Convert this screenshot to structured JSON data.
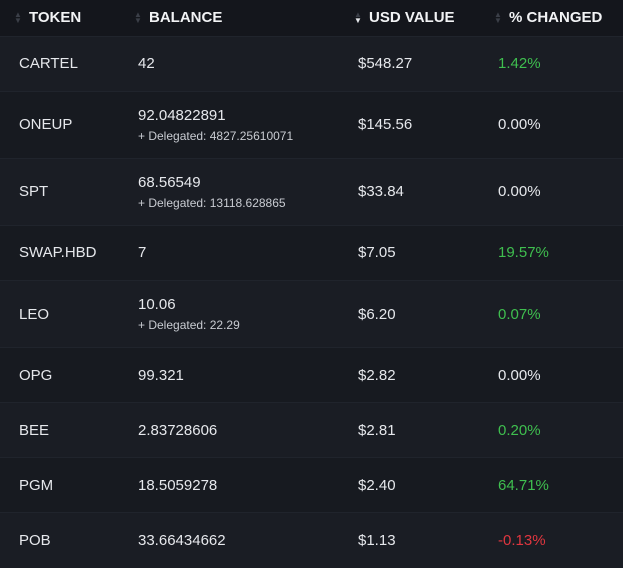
{
  "header": {
    "token": "TOKEN",
    "balance": "BALANCE",
    "usd_value": "USD VALUE",
    "changed": "% CHANGED",
    "sort_icon": "sort-updown-icon",
    "active_sort": "usd_value-descending"
  },
  "colors": {
    "positive": "#3fbf4f",
    "neutral": "#e6e8ec",
    "negative": "#e0363f",
    "background": "#181b22"
  },
  "rows": [
    {
      "token": "CARTEL",
      "balance": "42",
      "delegated": "",
      "usd": "$548.27",
      "change": "1.42%",
      "trend": "pos"
    },
    {
      "token": "ONEUP",
      "balance": "92.04822891",
      "delegated": "+ Delegated: 4827.25610071",
      "usd": "$145.56",
      "change": "0.00%",
      "trend": "neutral"
    },
    {
      "token": "SPT",
      "balance": "68.56549",
      "delegated": "+ Delegated: 13118.628865",
      "usd": "$33.84",
      "change": "0.00%",
      "trend": "neutral"
    },
    {
      "token": "SWAP.HBD",
      "balance": "7",
      "delegated": "",
      "usd": "$7.05",
      "change": "19.57%",
      "trend": "pos"
    },
    {
      "token": "LEO",
      "balance": "10.06",
      "delegated": "+ Delegated: 22.29",
      "usd": "$6.20",
      "change": "0.07%",
      "trend": "pos"
    },
    {
      "token": "OPG",
      "balance": "99.321",
      "delegated": "",
      "usd": "$2.82",
      "change": "0.00%",
      "trend": "neutral"
    },
    {
      "token": "BEE",
      "balance": "2.83728606",
      "delegated": "",
      "usd": "$2.81",
      "change": "0.20%",
      "trend": "pos"
    },
    {
      "token": "PGM",
      "balance": "18.5059278",
      "delegated": "",
      "usd": "$2.40",
      "change": "64.71%",
      "trend": "pos"
    },
    {
      "token": "POB",
      "balance": "33.66434662",
      "delegated": "",
      "usd": "$1.13",
      "change": "-0.13%",
      "trend": "neg"
    }
  ]
}
